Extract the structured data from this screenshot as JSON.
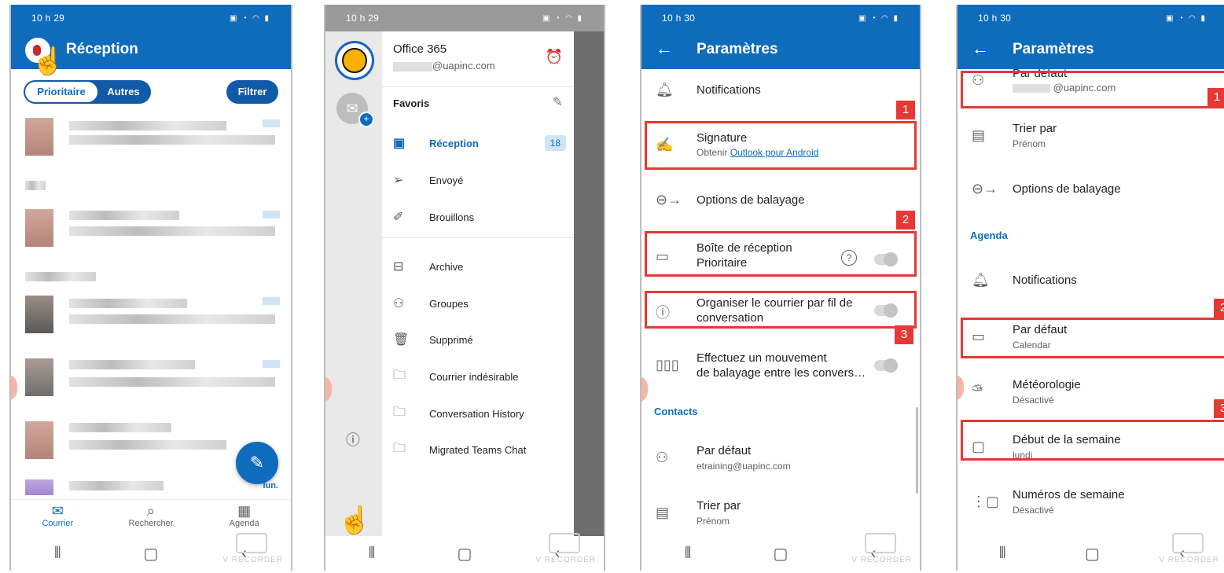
{
  "phone1": {
    "status_time": "10 h 29",
    "title": "Réception",
    "tabs": [
      "Prioritaire",
      "Autres"
    ],
    "filter": "Filtrer",
    "time_label": "lun.",
    "bottom_tabs": [
      "Courrier",
      "Rechercher",
      "Agenda"
    ]
  },
  "phone2": {
    "status_time": "10 h 29",
    "account": "Office 365",
    "email_domain": "@uapinc.com",
    "favorites": "Favoris",
    "items": [
      {
        "label": "Réception",
        "icon": "inbox-icon",
        "badge": "18"
      },
      {
        "label": "Envoyé",
        "icon": "send-icon"
      },
      {
        "label": "Brouillons",
        "icon": "drafts-icon"
      },
      {
        "label": "Archive",
        "icon": "archive-icon"
      },
      {
        "label": "Groupes",
        "icon": "groups-icon"
      },
      {
        "label": "Supprimé",
        "icon": "trash-icon"
      },
      {
        "label": "Courrier indésirable",
        "icon": "junk-folder-icon"
      },
      {
        "label": "Conversation History",
        "icon": "folder-icon"
      },
      {
        "label": "Migrated Teams Chat",
        "icon": "folder-icon"
      }
    ]
  },
  "phone3": {
    "status_time": "10 h 30",
    "title": "Paramètres",
    "rows": {
      "notifications": "Notifications",
      "signature": "Signature",
      "signature_sub_prefix": "Obtenir ",
      "signature_link": "Outlook pour Android",
      "swipe": "Options de balayage",
      "focused_line1": "Boîte de réception",
      "focused_line2": "Prioritaire",
      "thread_line1": "Organiser le courrier par fil de",
      "thread_line2": "conversation",
      "swipe_conv_line1": "Effectuez un mouvement",
      "swipe_conv_line2": "de balayage entre les convers…",
      "contacts_section": "Contacts",
      "default": "Par défaut",
      "default_sub": "etraining@uapinc.com",
      "sort": "Trier par",
      "sort_sub": "Prénom"
    },
    "markers": [
      "1",
      "2",
      "3"
    ]
  },
  "phone4": {
    "status_time": "10 h 30",
    "title": "Paramètres",
    "rows": {
      "default_top": "Par défaut",
      "default_top_sub": "@uapinc.com",
      "sort": "Trier par",
      "sort_sub": "Prénom",
      "swipe": "Options de balayage",
      "agenda_section": "Agenda",
      "notifications": "Notifications",
      "cal_default": "Par défaut",
      "cal_default_sub": "Calendar",
      "weather": "Météorologie",
      "weather_sub": "Désactivé",
      "week_start": "Début de la semaine",
      "week_start_sub": "lundi",
      "week_numbers": "Numéros de semaine",
      "week_numbers_sub": "Désactivé"
    },
    "markers": [
      "1",
      "2",
      "3"
    ]
  },
  "watermark": "V RECORDER",
  "colors": {
    "brand_blue": "#0f6cbd",
    "highlight_red": "#e53935"
  }
}
